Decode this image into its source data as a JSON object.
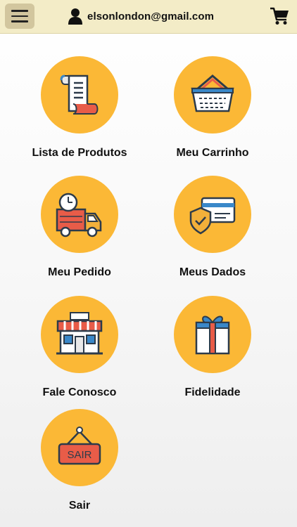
{
  "header": {
    "menu_icon": "hamburger-icon",
    "user_icon": "person-icon",
    "user_email": "elsonlondon@gmail.com",
    "cart_icon": "shopping-cart-icon",
    "bar_color": "#f3ecc7"
  },
  "accent_color": "#fbb836",
  "menu": {
    "items": [
      {
        "label": "Lista de Produtos",
        "icon": "receipt-list-icon"
      },
      {
        "label": "Meu Carrinho",
        "icon": "basket-icon"
      },
      {
        "label": "Meu Pedido",
        "icon": "delivery-truck-icon"
      },
      {
        "label": "Meus Dados",
        "icon": "card-shield-icon"
      },
      {
        "label": "Fale Conosco",
        "icon": "storefront-icon"
      },
      {
        "label": "Fidelidade",
        "icon": "gift-icon"
      },
      {
        "label": "Sair",
        "icon": "sign-icon",
        "sign_text": "SAIR"
      }
    ]
  }
}
